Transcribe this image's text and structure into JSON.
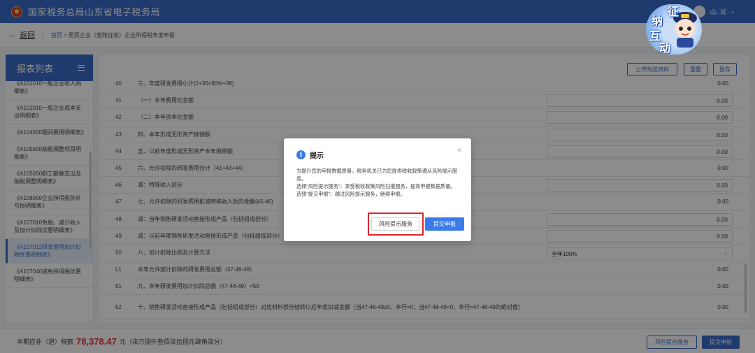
{
  "header": {
    "site_title": "国家税务总局山东省电子税务局",
    "user_name": "山..试",
    "user_caret": "⌄"
  },
  "mascot": {
    "chars": [
      "征",
      "纳",
      "互",
      "动"
    ]
  },
  "breadcrumb": {
    "back_arrow": "←",
    "back_label": "返回",
    "separator": "|",
    "home": "首页",
    "trail": " > 居民企业（查账征收）企业所得税年度申报"
  },
  "sidebar": {
    "title": "报表列表",
    "items": [
      "《A101010一般企业收入明细表》",
      "《A102010一般企业成本支出明细表》",
      "《A104000期间费用明细表》",
      "《A105000纳税调整项目明细表》",
      "《A105050职工薪酬支出及纳税调整明细表》",
      "《A106000企业所得税弥补亏损明细表》",
      "《A107010免税、减计收入及加计扣除优惠明细表》",
      "《A107012研发费用加计扣除优惠明细表》",
      "《A107040减免所得税优惠明细表》"
    ],
    "active_index": 7
  },
  "toolbar": {
    "upload_label": "上传附送资料",
    "reset_label": "重置",
    "save_label": "暂存"
  },
  "table": {
    "rows": [
      {
        "no": "40",
        "label": "三、年度研发费用小计(2+36×80%+38)",
        "value": "0.00",
        "box": false
      },
      {
        "no": "41",
        "label": "（一）本年费用化金额",
        "value": "0.00",
        "box": true
      },
      {
        "no": "42",
        "label": "（二）本年资本化金额",
        "value": "0.00",
        "box": true
      },
      {
        "no": "43",
        "label": "四、本年形成无形资产摊销额",
        "value": "0.00",
        "box": true
      },
      {
        "no": "44",
        "label": "五、以前年度形成无形资产本年摊销额",
        "value": "0.00",
        "box": true
      },
      {
        "no": "45",
        "label": "六、允许扣除的研发费用合计（41+43+44）",
        "value": "0.00",
        "box": false
      },
      {
        "no": "46",
        "label": "减：特殊收入部分",
        "value": "0.00",
        "box": true
      },
      {
        "no": "47",
        "label": "七、允许扣除的研发费用抵减特殊收入后的金额(45-46)",
        "value": "0.00",
        "box": false
      },
      {
        "no": "48",
        "label": "减：当年销售研发活动直接形成产品（包括组成部分）",
        "value": "0.00",
        "box": true
      },
      {
        "no": "49",
        "label": "减：以前年度销售研发活动直接形成产品（包括组成部分）",
        "value": "0.00",
        "box": true
      },
      {
        "no": "50",
        "label": "八、加计扣除比例及计算方法",
        "value": "全年100%",
        "box": true,
        "select": true
      },
      {
        "no": "L1",
        "label": "本年允许加计扣除的研发费用总额（47-48-49）",
        "value": "0.00",
        "box": false
      },
      {
        "no": "51",
        "label": "九、本年研发费用加计扣除总额（47-48-49）×50",
        "value": "0.00",
        "box": false
      },
      {
        "no": "52",
        "label": "十、销售研发活动直接形成产品（包括组成部分）对应材料部分结转以后年度扣减金额（当47-48-49≥0，本行=0；当47-48-49<0，本行=47-48-49的绝对值）",
        "value": "0.00",
        "box": false
      }
    ]
  },
  "footer": {
    "label": "本期应补（退）税额",
    "amount": "78,378.47",
    "unit": "元（柒万捌仟叁佰柒拾捌元肆角柒分）",
    "risk_button": "风险提示服务",
    "submit_button": "提交申报"
  },
  "dialog": {
    "title": "提示",
    "close": "×",
    "info_glyph": "i",
    "paragraphs": [
      "为提升您的申报数据质量，税务机关已为您提供税收政策遵从风险提示服务。",
      "选择“风险提示服务”：享受税收政策风险扫描服务，提高申报数据质量。",
      "选择“提交申报”：跳过风险提示服务，继续申报。"
    ],
    "risk_button": "风险提示服务",
    "submit_button": "提交申报"
  },
  "colors": {
    "primary": "#3a6cc8",
    "amount": "#d9363e",
    "highlight": "#e0252b"
  }
}
